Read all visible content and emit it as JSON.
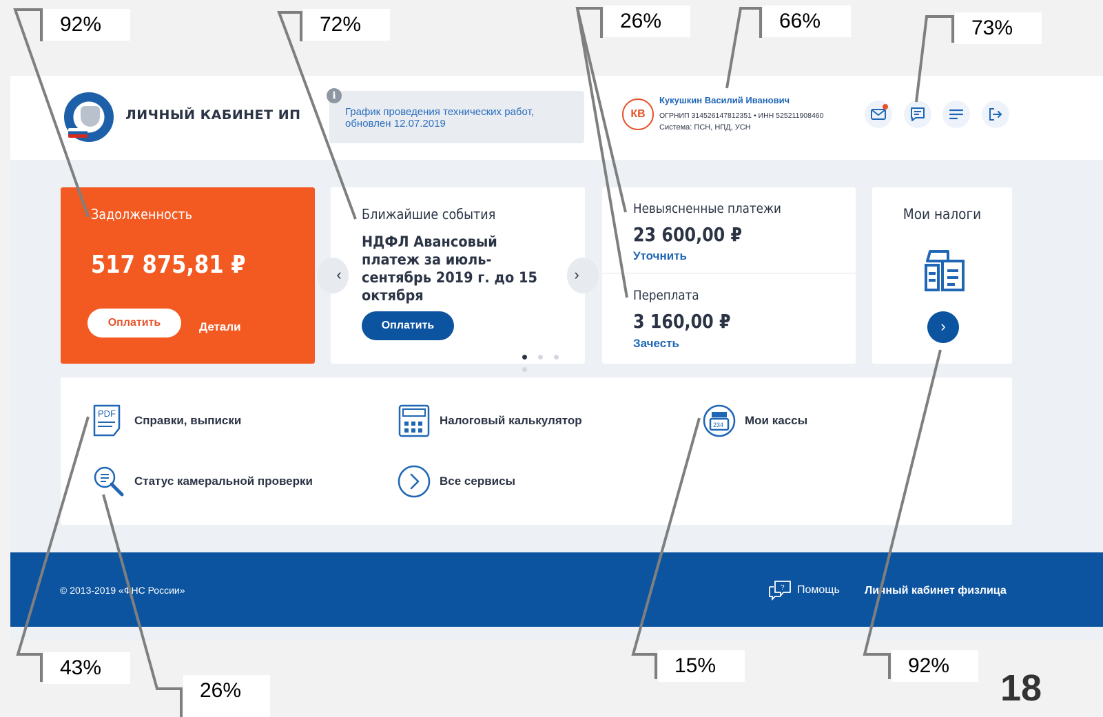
{
  "header": {
    "brand_title": "ЛИЧНЫЙ КАБИНЕТ ИП",
    "notice_text": "График проведения технических работ, обновлен 12.07.2019",
    "user_initials": "КВ",
    "user_name": "Кукушкин Василий Иванович",
    "user_ids": "ОГРНИП 314526147812351  •  ИНН 525211908460",
    "user_system": "Система: ПСН, НПД, УСН",
    "icons": [
      "mail-icon",
      "chat-icon",
      "menu-icon",
      "logout-icon"
    ]
  },
  "debt_card": {
    "title": "Задолженность",
    "amount": "517 875,81 ₽",
    "pay_label": "Оплатить",
    "details_label": "Детали"
  },
  "events_card": {
    "title": "Ближайшие события",
    "text": "НДФЛ Авансовый платеж за июль-сентябрь 2019 г. до 15 октября",
    "pay_label": "Оплатить",
    "prev": "‹",
    "next": "›"
  },
  "payments_card": {
    "unclear_label": "Невыясненные платежи",
    "unclear_amount": "23 600,00 ₽",
    "unclear_link": "Уточнить",
    "overpay_label": "Переплата",
    "overpay_amount": "3 160,00 ₽",
    "overpay_link": "Зачесть"
  },
  "taxes_card": {
    "title": "Мои налоги",
    "arrow": "›"
  },
  "services": [
    {
      "label": "Справки, выписки"
    },
    {
      "label": "Налоговый калькулятор"
    },
    {
      "label": "Мои кассы"
    },
    {
      "label": "Статус камеральной проверки"
    },
    {
      "label": "Все сервисы"
    }
  ],
  "footer": {
    "copyright": "© 2013-2019 «ФНС России»",
    "help": "Помощь",
    "personal_link": "Личный кабинет физлица"
  },
  "annotations": {
    "a1": "92%",
    "a2": "72%",
    "a3": "26%",
    "a4": "66%",
    "a5": "73%",
    "a6": "43%",
    "a7": "26%",
    "a8": "15%",
    "a9": "92%"
  },
  "slide_number": "18",
  "colors": {
    "accent_orange": "#f25a22",
    "primary_blue": "#0c54a0",
    "link_blue": "#1f66b5"
  }
}
